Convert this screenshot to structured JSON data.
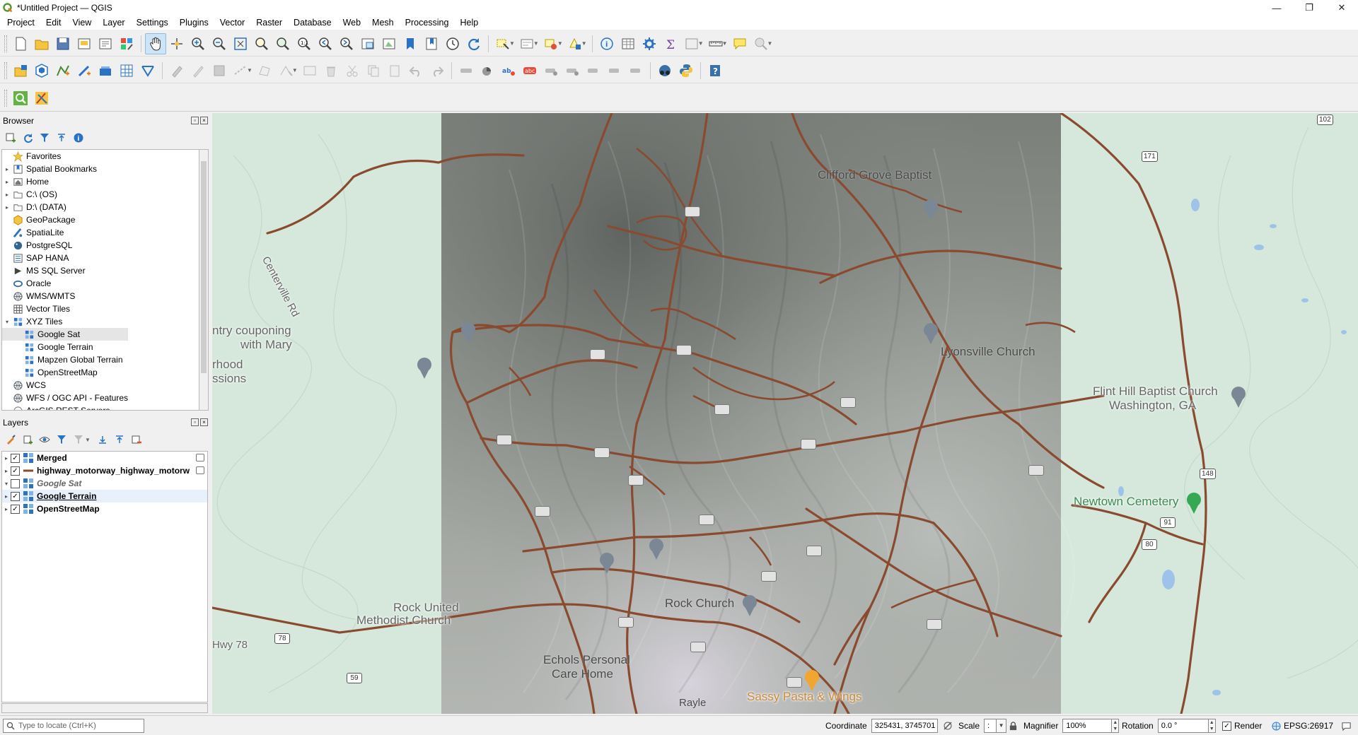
{
  "window": {
    "title": "*Untitled Project — QGIS",
    "minimize": "—",
    "maximize": "❐",
    "close": "✕"
  },
  "menu": [
    "Project",
    "Edit",
    "View",
    "Layer",
    "Settings",
    "Plugins",
    "Vector",
    "Raster",
    "Database",
    "Web",
    "Mesh",
    "Processing",
    "Help"
  ],
  "browser": {
    "title": "Browser",
    "items": [
      {
        "label": "Favorites",
        "icon": "star-icon",
        "arrow": "",
        "indent": 0
      },
      {
        "label": "Spatial Bookmarks",
        "icon": "bookmark-icon",
        "arrow": "▸",
        "indent": 0
      },
      {
        "label": "Home",
        "icon": "home-folder-icon",
        "arrow": "▸",
        "indent": 0
      },
      {
        "label": "C:\\ (OS)",
        "icon": "drive-icon",
        "arrow": "▸",
        "indent": 0
      },
      {
        "label": "D:\\ (DATA)",
        "icon": "drive-icon",
        "arrow": "▸",
        "indent": 0
      },
      {
        "label": "GeoPackage",
        "icon": "geopackage-icon",
        "arrow": "",
        "indent": 0
      },
      {
        "label": "SpatiaLite",
        "icon": "spatialite-icon",
        "arrow": "",
        "indent": 0
      },
      {
        "label": "PostgreSQL",
        "icon": "postgresql-icon",
        "arrow": "",
        "indent": 0
      },
      {
        "label": "SAP HANA",
        "icon": "sap-hana-icon",
        "arrow": "",
        "indent": 0
      },
      {
        "label": "MS SQL Server",
        "icon": "mssql-icon",
        "arrow": "",
        "indent": 0
      },
      {
        "label": "Oracle",
        "icon": "oracle-icon",
        "arrow": "",
        "indent": 0
      },
      {
        "label": "WMS/WMTS",
        "icon": "wms-globe-icon",
        "arrow": "",
        "indent": 0
      },
      {
        "label": "Vector Tiles",
        "icon": "vector-tiles-icon",
        "arrow": "",
        "indent": 0
      },
      {
        "label": "XYZ Tiles",
        "icon": "xyz-tiles-icon",
        "arrow": "▾",
        "indent": 0
      },
      {
        "label": "Google Sat",
        "icon": "xyz-tile-layer-icon",
        "arrow": "",
        "indent": 1,
        "selected": true
      },
      {
        "label": "Google Terrain",
        "icon": "xyz-tile-layer-icon",
        "arrow": "",
        "indent": 1
      },
      {
        "label": "Mapzen Global Terrain",
        "icon": "xyz-tile-layer-icon",
        "arrow": "",
        "indent": 1
      },
      {
        "label": "OpenStreetMap",
        "icon": "xyz-tile-layer-icon",
        "arrow": "",
        "indent": 1
      },
      {
        "label": "WCS",
        "icon": "wcs-globe-icon",
        "arrow": "",
        "indent": 0
      },
      {
        "label": "WFS / OGC API - Features",
        "icon": "wfs-globe-icon",
        "arrow": "",
        "indent": 0
      },
      {
        "label": "ArcGIS REST Servers",
        "icon": "arcgis-icon",
        "arrow": "",
        "indent": 0
      }
    ]
  },
  "layers": {
    "title": "Layers",
    "items": [
      {
        "label": "Merged",
        "checked": true,
        "icon": "raster-layer-icon",
        "style": ""
      },
      {
        "label": "highway_motorway_highway_motorw",
        "checked": true,
        "icon": "line-layer-icon",
        "style": ""
      },
      {
        "label": "Google Sat",
        "checked": false,
        "icon": "raster-layer-icon",
        "style": "italic"
      },
      {
        "label": "Google Terrain",
        "checked": true,
        "icon": "raster-layer-icon",
        "style": "underlined"
      },
      {
        "label": "OpenStreetMap",
        "checked": true,
        "icon": "raster-layer-icon",
        "style": ""
      }
    ]
  },
  "map": {
    "labels": {
      "clifford": "Clifford Grove Baptist",
      "lyonsville": "Lyonsville Church",
      "flint1": "Flint Hill Baptist Church",
      "flint2": "Washington, GA",
      "newtown": "Newtown Cemetery",
      "country1": "ntry couponing",
      "country2": "with Mary",
      "hood1": "rhood",
      "hood2": "ssions",
      "rock1": "Rock United",
      "rock2": "Methodist Church",
      "rockch": "Rock Church",
      "echols1": "Echols Personal",
      "echols2": "Care Home",
      "sassy": "Sassy Pasta & Wings",
      "hwy78": "Hwy 78",
      "centerville": "Centerville Rd",
      "rayle": "Rayle"
    },
    "shields": [
      "102",
      "171",
      "78",
      "59",
      "148",
      "91",
      "80"
    ],
    "colors": {
      "water_green": "#d9ebdf",
      "road": "#8a4a2f",
      "hillshade": "#8d918c"
    }
  },
  "status": {
    "locator_placeholder": "Type to locate (Ctrl+K)",
    "coordinate_label": "Coordinate",
    "coordinate_value": "325431, 3745701",
    "scale_label": "Scale",
    "scale_value": ":",
    "magnifier_label": "Magnifier",
    "magnifier_value": "100%",
    "rotation_label": "Rotation",
    "rotation_value": "0.0 °",
    "render_label": "Render",
    "crs": "EPSG:26917"
  }
}
